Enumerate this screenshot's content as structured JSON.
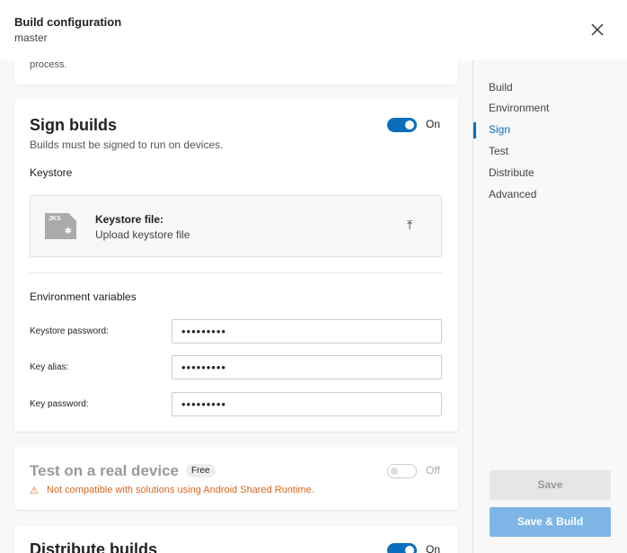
{
  "header": {
    "title": "Build configuration",
    "subtitle": "master"
  },
  "prev_card": {
    "text_tail": "process."
  },
  "sign": {
    "title": "Sign builds",
    "toggle_label": "On",
    "description": "Builds must be signed to run on devices.",
    "keystore_heading": "Keystore",
    "file_icon_text": "JKS",
    "file_label": "Keystore file:",
    "file_action": "Upload keystore file",
    "env_heading": "Environment variables",
    "fields": [
      {
        "label": "Keystore password:",
        "value": "•••••••••"
      },
      {
        "label": "Key alias:",
        "value": "•••••••••"
      },
      {
        "label": "Key password:",
        "value": "•••••••••"
      }
    ]
  },
  "test": {
    "title": "Test on a real device",
    "badge": "Free",
    "toggle_label": "Off",
    "warning": "Not compatible with solutions using Android Shared Runtime."
  },
  "distribute": {
    "title": "Distribute builds",
    "toggle_label": "On"
  },
  "sidebar": {
    "items": [
      {
        "label": "Build"
      },
      {
        "label": "Environment"
      },
      {
        "label": "Sign"
      },
      {
        "label": "Test"
      },
      {
        "label": "Distribute"
      },
      {
        "label": "Advanced"
      }
    ],
    "save_label": "Save",
    "save_build_label": "Save & Build"
  }
}
